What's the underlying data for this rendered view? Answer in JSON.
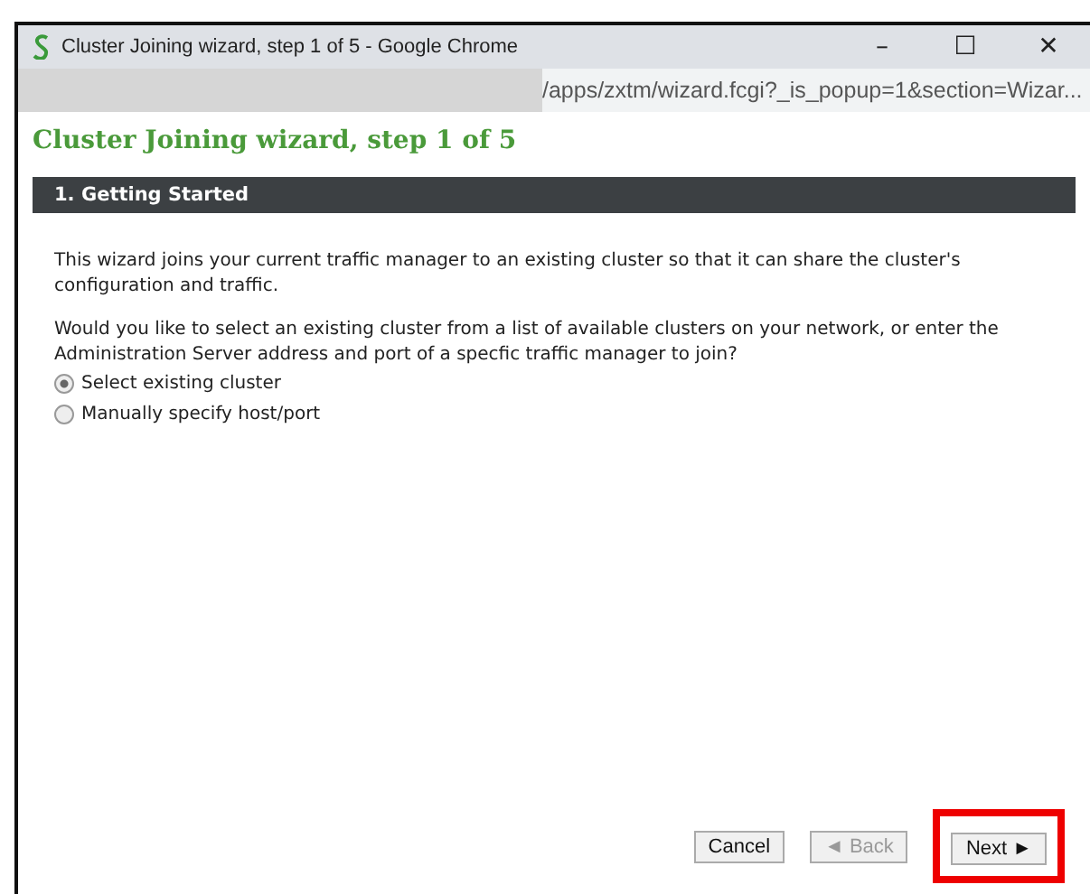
{
  "window": {
    "title": "Cluster Joining wizard, step 1 of 5 - Google Chrome",
    "controls": [
      "–",
      "☐",
      "✕"
    ]
  },
  "address_bar": {
    "url": "/apps/zxtm/wizard.fcgi?_is_popup=1&section=Wizar..."
  },
  "heading": "Cluster Joining wizard, step 1 of 5",
  "section": {
    "title": "1. Getting Started"
  },
  "paragraphs": [
    "This wizard joins your current traffic manager to an existing cluster so that it can share the cluster's configuration and traffic.",
    "Would you like to select an existing cluster from a list of available clusters on your network, or enter the Administration Server address and port of a specfic traffic manager to join?"
  ],
  "options": [
    {
      "label": "Select existing cluster",
      "selected": true
    },
    {
      "label": "Manually specify host/port",
      "selected": false
    }
  ],
  "buttons": [
    {
      "label": "Cancel",
      "disabled": false,
      "highlighted": false
    },
    {
      "label": "◄ Back",
      "disabled": true,
      "highlighted": false
    },
    {
      "label": "Next ►",
      "disabled": false,
      "highlighted": true
    }
  ]
}
